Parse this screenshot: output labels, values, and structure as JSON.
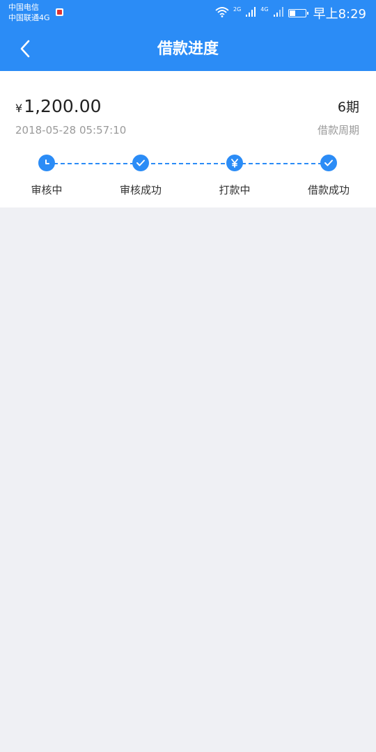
{
  "status_bar": {
    "carrier_1": "中国电信",
    "carrier_2": "中国联通4G",
    "signal_1_label": "2G",
    "signal_2_label": "4G",
    "time": "早上8:29",
    "battery_level": 0.35
  },
  "header": {
    "title": "借款进度",
    "back_icon": "chevron-left-icon"
  },
  "loan": {
    "currency_symbol": "¥",
    "amount": "1,200.00",
    "periods": "6期",
    "date": "2018-05-28 05:57:10",
    "period_label": "借款周期"
  },
  "steps": [
    {
      "label": "审核中",
      "icon": "clock-icon"
    },
    {
      "label": "审核成功",
      "icon": "check-icon"
    },
    {
      "label": "打款中",
      "icon": "yen-icon"
    },
    {
      "label": "借款成功",
      "icon": "check-icon"
    }
  ],
  "colors": {
    "accent": "#2b8cf6",
    "background": "#eff0f4",
    "muted_text": "#9a9a9a"
  }
}
